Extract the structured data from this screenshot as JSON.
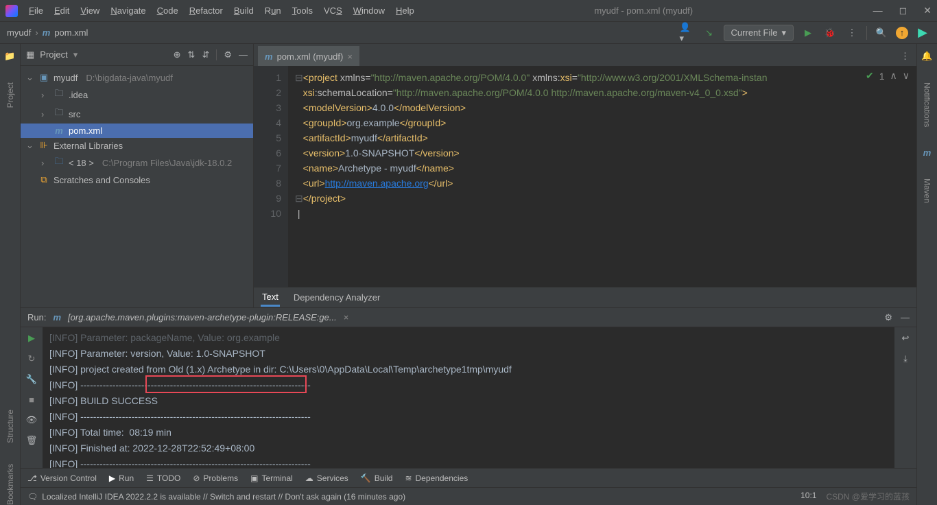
{
  "window": {
    "title": "myudf - pom.xml (myudf)"
  },
  "menu": [
    "File",
    "Edit",
    "View",
    "Navigate",
    "Code",
    "Refactor",
    "Build",
    "Run",
    "Tools",
    "VCS",
    "Window",
    "Help"
  ],
  "breadcrumb": {
    "project": "myudf",
    "file": "pom.xml"
  },
  "toolbar": {
    "current_file": "Current File"
  },
  "project_panel": {
    "title": "Project",
    "tree": {
      "root": "myudf",
      "root_path": "D:\\bigdata-java\\myudf",
      "idea": ".idea",
      "src": "src",
      "pom": "pom.xml",
      "ext_lib": "External Libraries",
      "jdk": "< 18 >",
      "jdk_path": "C:\\Program Files\\Java\\jdk-18.0.2",
      "scratches": "Scratches and Consoles"
    }
  },
  "editor": {
    "tab_label": "pom.xml (myudf)",
    "status_count": "1",
    "bottom_tabs": {
      "text": "Text",
      "dep": "Dependency Analyzer"
    },
    "lines": {
      "l1": "<project xmlns=\"http://maven.apache.org/POM/4.0.0\" xmlns:xsi=\"http://www.w3.org/2001/XMLSchema-instan",
      "l2": "  xsi:schemaLocation=\"http://maven.apache.org/POM/4.0.0 http://maven.apache.org/maven-v4_0_0.xsd\">",
      "l3": "  <modelVersion>4.0.0</modelVersion>",
      "l4": "  <groupId>org.example</groupId>",
      "l5": "  <artifactId>myudf</artifactId>",
      "l6": "  <version>1.0-SNAPSHOT</version>",
      "l7": "  <name>Archetype - myudf</name>",
      "l8": "  <url>http://maven.apache.org</url>",
      "l9": "</project>"
    }
  },
  "run": {
    "label": "Run:",
    "config": "[org.apache.maven.plugins:maven-archetype-plugin:RELEASE:ge...",
    "console": [
      "[INFO] Parameter: packageName, Value: org.example",
      "[INFO] Parameter: version, Value: 1.0-SNAPSHOT",
      "[INFO] project created from Old (1.x) Archetype in dir: C:\\Users\\0\\AppData\\Local\\Temp\\archetype1tmp\\myudf",
      "[INFO] ------------------------------------------------------------------------",
      "[INFO] BUILD SUCCESS",
      "[INFO] ------------------------------------------------------------------------",
      "[INFO] Total time:  08:19 min",
      "[INFO] Finished at: 2022-12-28T22:52:49+08:00",
      "[INFO] ------------------------------------------------------------------------"
    ]
  },
  "rails": {
    "project": "Project",
    "structure": "Structure",
    "bookmarks": "Bookmarks",
    "notifications": "Notifications",
    "maven": "Maven"
  },
  "bottom_bar": {
    "vcs": "Version Control",
    "run": "Run",
    "todo": "TODO",
    "problems": "Problems",
    "terminal": "Terminal",
    "services": "Services",
    "build": "Build",
    "deps": "Dependencies"
  },
  "status": {
    "msg": "Localized IntelliJ IDEA 2022.2.2 is available // Switch and restart // Don't ask again (16 minutes ago)",
    "pos": "10:1",
    "watermark": "CSDN @爱学习的蓝孩"
  }
}
